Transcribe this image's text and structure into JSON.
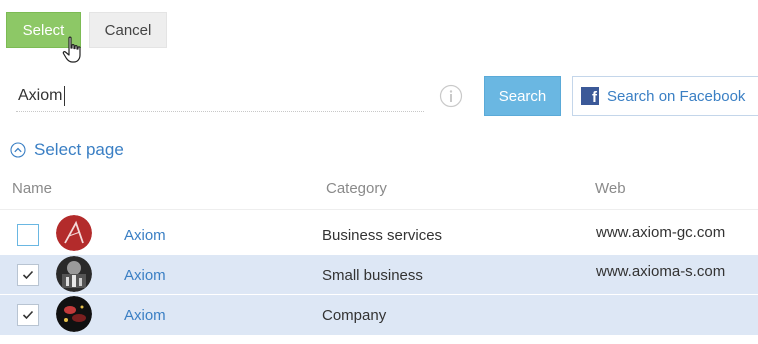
{
  "toolbar": {
    "select_label": "Select",
    "cancel_label": "Cancel"
  },
  "search": {
    "value": "Axiom",
    "button_label": "Search",
    "facebook_label": "Search on Facebook"
  },
  "select_page": {
    "label": "Select page"
  },
  "table": {
    "columns": [
      "Name",
      "Category",
      "Web"
    ],
    "rows": [
      {
        "name": "Axiom",
        "category": "Business services",
        "web": "www.axiom-gc.com",
        "checked": false
      },
      {
        "name": "Axiom",
        "category": "Small business",
        "web": "www.axioma-s.com",
        "checked": true
      },
      {
        "name": "Axiom",
        "category": "Company",
        "web": "",
        "checked": true
      }
    ]
  },
  "colors": {
    "select_button": "#8dc866",
    "search_button": "#6ab7e2",
    "link": "#3a7fc4",
    "selected_row": "#dde7f5",
    "facebook_brand": "#3b5998"
  },
  "icons": {
    "cursor": "hand-pointer-icon",
    "info": "info-icon",
    "chevron": "chevron-up-circle-icon",
    "facebook": "facebook-icon",
    "checkbox_checked": "check-icon"
  }
}
